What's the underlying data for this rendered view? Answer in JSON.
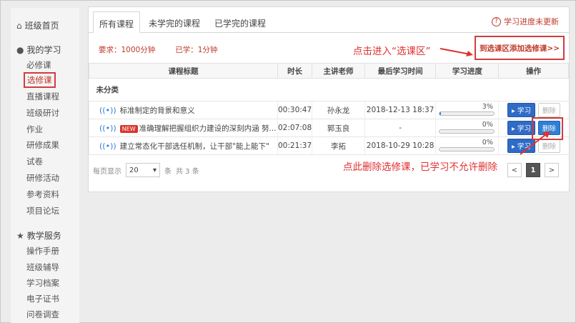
{
  "sidebar": {
    "home": "班级首页",
    "my_learning": "我的学习",
    "items": [
      "必修课",
      "选修课",
      "直播课程",
      "班级研讨",
      "作业",
      "研修成果",
      "试卷",
      "研修活动",
      "参考资料",
      "项目论坛"
    ],
    "teaching_services": "教学服务",
    "service_items": [
      "操作手册",
      "班级辅导",
      "学习档案",
      "电子证书",
      "问卷调查"
    ]
  },
  "tabs": [
    "所有课程",
    "未学完的课程",
    "已学完的课程"
  ],
  "help_text": "学习进度未更新",
  "requirement": "要求：1000分钟",
  "learned": "已学：1分钟",
  "annotation_select": "点击进入“选课区”",
  "add_elective_link": "到选课区添加选修课>>",
  "table": {
    "headers": [
      "课程标题",
      "时长",
      "主讲老师",
      "最后学习时间",
      "学习进度",
      "操作"
    ],
    "category": "未分类",
    "rows": [
      {
        "title": "标准制定的背景和意义",
        "is_new": false,
        "duration": "00:30:47",
        "teacher": "孙永龙",
        "last_time": "2018-12-13 18:37",
        "progress_text": "3%",
        "progress": 3,
        "delete_enabled": false
      },
      {
        "title": "准确理解把握组织力建设的深刻内涵 努...",
        "is_new": true,
        "new_label": "NEW",
        "duration": "02:07:08",
        "teacher": "郭玉良",
        "last_time": "-",
        "progress_text": "0%",
        "progress": 0,
        "delete_enabled": true
      },
      {
        "title": "建立常态化干部选任机制，让干部\"能上能下\"",
        "is_new": false,
        "duration": "00:21:37",
        "teacher": "李拓",
        "last_time": "2018-10-29 10:28",
        "progress_text": "0%",
        "progress": 0,
        "delete_enabled": false
      }
    ],
    "study_label": "学习",
    "delete_label": "删除"
  },
  "pager": {
    "per_page_label": "每页显示",
    "per_page_value": "20",
    "unit": "条",
    "total": "共 3 条",
    "current_page": "1",
    "prev": "<",
    "next": ">"
  },
  "annotation_delete": "点此删除选修课，已学习不允许删除",
  "colors": {
    "accent_red": "#d23c3c",
    "button_blue": "#2f6bc7"
  }
}
